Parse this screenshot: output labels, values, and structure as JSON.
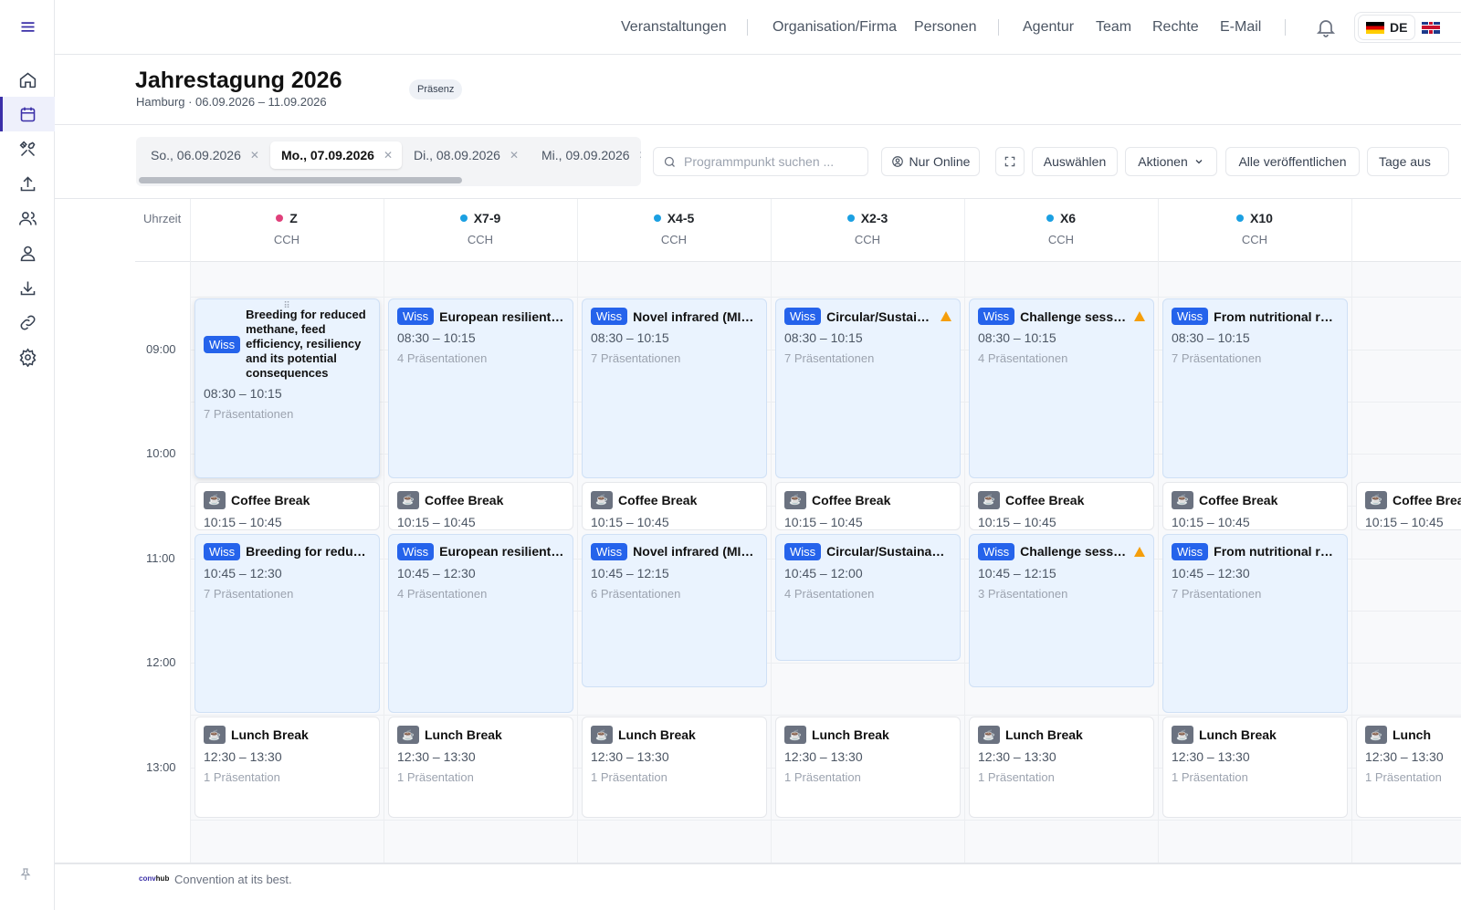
{
  "nav": {
    "items": [
      "Veranstaltungen",
      "Organisation/Firma",
      "Personen",
      "Agentur",
      "Team",
      "Rechte",
      "E-Mail"
    ],
    "lang_label": "DE"
  },
  "event": {
    "title": "Jahrestagung 2026",
    "subtitle": "Hamburg · 06.09.2026 – 11.09.2026",
    "badge": "Präsenz"
  },
  "day_tabs": [
    {
      "label": "So., 06.09.2026",
      "active": false
    },
    {
      "label": "Mo., 07.09.2026",
      "active": true
    },
    {
      "label": "Di., 08.09.2026",
      "active": false
    },
    {
      "label": "Mi., 09.09.2026",
      "active": false
    }
  ],
  "toolbar": {
    "search_placeholder": "Programmpunkt suchen ...",
    "online_label": "Nur Online",
    "select_label": "Auswählen",
    "actions_label": "Aktionen",
    "publish_label": "Alle veröffentlichen",
    "days_label": "Tage aus"
  },
  "grid": {
    "time_header": "Uhrzeit",
    "times": [
      "09:00",
      "10:00",
      "11:00",
      "12:00",
      "13:00"
    ],
    "columns": [
      {
        "name": "Z",
        "location": "CCH",
        "dot": "#e0407b"
      },
      {
        "name": "X7-9",
        "location": "CCH",
        "dot": "#1ba0e2"
      },
      {
        "name": "X4-5",
        "location": "CCH",
        "dot": "#1ba0e2"
      },
      {
        "name": "X2-3",
        "location": "CCH",
        "dot": "#1ba0e2"
      },
      {
        "name": "X6",
        "location": "CCH",
        "dot": "#1ba0e2"
      },
      {
        "name": "X10",
        "location": "CCH",
        "dot": "#1ba0e2"
      }
    ]
  },
  "sessions": [
    {
      "col": 0,
      "tag": "Wiss",
      "title": "Breeding for reduced methane, feed efficiency, resiliency and its potential consequences",
      "time": "08:30 – 10:15",
      "pres": "7 Präsentationen",
      "start": "08:30",
      "end": "10:15",
      "warn": false,
      "expanded": true
    },
    {
      "col": 1,
      "tag": "Wiss",
      "title": "European resilient li...",
      "time": "08:30 – 10:15",
      "pres": "4 Präsentationen",
      "start": "08:30",
      "end": "10:15",
      "warn": false
    },
    {
      "col": 2,
      "tag": "Wiss",
      "title": "Novel infrared (MIR/...",
      "time": "08:30 – 10:15",
      "pres": "7 Präsentationen",
      "start": "08:30",
      "end": "10:15",
      "warn": false
    },
    {
      "col": 3,
      "tag": "Wiss",
      "title": "Circular/Sustaina...",
      "time": "08:30 – 10:15",
      "pres": "7 Präsentationen",
      "start": "08:30",
      "end": "10:15",
      "warn": true
    },
    {
      "col": 4,
      "tag": "Wiss",
      "title": "Challenge sessio...",
      "time": "08:30 – 10:15",
      "pres": "4 Präsentationen",
      "start": "08:30",
      "end": "10:15",
      "warn": true
    },
    {
      "col": 5,
      "tag": "Wiss",
      "title": "From nutritional rec...",
      "time": "08:30 – 10:15",
      "pres": "7 Präsentationen",
      "start": "08:30",
      "end": "10:15",
      "warn": false
    },
    {
      "col": 0,
      "brk": true,
      "title": "Coffee Break",
      "time": "10:15 – 10:45",
      "start": "10:15",
      "end": "10:45"
    },
    {
      "col": 1,
      "brk": true,
      "title": "Coffee Break",
      "time": "10:15 – 10:45",
      "start": "10:15",
      "end": "10:45"
    },
    {
      "col": 2,
      "brk": true,
      "title": "Coffee Break",
      "time": "10:15 – 10:45",
      "start": "10:15",
      "end": "10:45"
    },
    {
      "col": 3,
      "brk": true,
      "title": "Coffee Break",
      "time": "10:15 – 10:45",
      "start": "10:15",
      "end": "10:45"
    },
    {
      "col": 4,
      "brk": true,
      "title": "Coffee Break",
      "time": "10:15 – 10:45",
      "start": "10:15",
      "end": "10:45"
    },
    {
      "col": 5,
      "brk": true,
      "title": "Coffee Break",
      "time": "10:15 – 10:45",
      "start": "10:15",
      "end": "10:45"
    },
    {
      "col": 6,
      "brk": true,
      "title": "Coffee Break",
      "time": "10:15 – 10:45",
      "start": "10:15",
      "end": "10:45"
    },
    {
      "col": 0,
      "tag": "Wiss",
      "title": "Breeding for reduce...",
      "time": "10:45 – 12:30",
      "pres": "7 Präsentationen",
      "start": "10:45",
      "end": "12:30",
      "warn": false
    },
    {
      "col": 1,
      "tag": "Wiss",
      "title": "European resilient li...",
      "time": "10:45 – 12:30",
      "pres": "4 Präsentationen",
      "start": "10:45",
      "end": "12:30",
      "warn": false
    },
    {
      "col": 2,
      "tag": "Wiss",
      "title": "Novel infrared (MIR/...",
      "time": "10:45 – 12:15",
      "pres": "6 Präsentationen",
      "start": "10:45",
      "end": "12:15",
      "warn": false
    },
    {
      "col": 3,
      "tag": "Wiss",
      "title": "Circular/Sustainable...",
      "time": "10:45 – 12:00",
      "pres": "4 Präsentationen",
      "start": "10:45",
      "end": "12:00",
      "warn": false
    },
    {
      "col": 4,
      "tag": "Wiss",
      "title": "Challenge sessio...",
      "time": "10:45 – 12:15",
      "pres": "3 Präsentationen",
      "start": "10:45",
      "end": "12:15",
      "warn": true
    },
    {
      "col": 5,
      "tag": "Wiss",
      "title": "From nutritional rec...",
      "time": "10:45 – 12:30",
      "pres": "7 Präsentationen",
      "start": "10:45",
      "end": "12:30",
      "warn": false
    },
    {
      "col": 0,
      "brk": true,
      "title": "Lunch Break",
      "time": "12:30 – 13:30",
      "pres": "1 Präsentation",
      "start": "12:30",
      "end": "13:30"
    },
    {
      "col": 1,
      "brk": true,
      "title": "Lunch Break",
      "time": "12:30 – 13:30",
      "pres": "1 Präsentation",
      "start": "12:30",
      "end": "13:30"
    },
    {
      "col": 2,
      "brk": true,
      "title": "Lunch Break",
      "time": "12:30 – 13:30",
      "pres": "1 Präsentation",
      "start": "12:30",
      "end": "13:30"
    },
    {
      "col": 3,
      "brk": true,
      "title": "Lunch Break",
      "time": "12:30 – 13:30",
      "pres": "1 Präsentation",
      "start": "12:30",
      "end": "13:30"
    },
    {
      "col": 4,
      "brk": true,
      "title": "Lunch Break",
      "time": "12:30 – 13:30",
      "pres": "1 Präsentation",
      "start": "12:30",
      "end": "13:30"
    },
    {
      "col": 5,
      "brk": true,
      "title": "Lunch Break",
      "time": "12:30 – 13:30",
      "pres": "1 Präsentation",
      "start": "12:30",
      "end": "13:30"
    },
    {
      "col": 6,
      "brk": true,
      "title": "Lunch",
      "time": "12:30 – 13:30",
      "pres": "1 Präsentation",
      "start": "12:30",
      "end": "13:30"
    }
  ],
  "footer": {
    "logo_a": "conv",
    "logo_b": "hub",
    "tagline": "Convention at its best."
  },
  "colors": {
    "accent": "#3b30a8",
    "wiss_tag": "#2563eb",
    "warn": "#f59e0b"
  }
}
